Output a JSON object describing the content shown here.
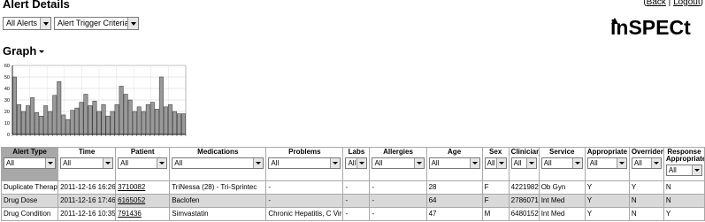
{
  "header": {
    "title": "Alert Details",
    "back_label": "Back",
    "separator": "|",
    "logout_label": "Logout",
    "logo_text": "inSPECt"
  },
  "filters": {
    "alerts_selected": "All Alerts",
    "criteria_selected": "Alert Trigger Criteria"
  },
  "graph": {
    "heading": "Graph",
    "icon": "chevron-down-icon"
  },
  "chart_data": {
    "type": "bar",
    "y_ticks": [
      "0",
      "10",
      "20",
      "30",
      "40",
      "50",
      "60"
    ],
    "ylim": [
      0,
      60
    ],
    "grid": true,
    "bar_color": "#999999",
    "values": [
      50,
      26,
      20,
      25,
      32,
      19,
      16,
      25,
      20,
      34,
      46,
      17,
      13,
      21,
      23,
      28,
      35,
      25,
      29,
      20,
      26,
      16,
      20,
      26,
      42,
      35,
      30,
      20,
      24,
      20,
      26,
      28,
      22,
      50,
      24,
      26,
      20,
      18,
      18
    ]
  },
  "table": {
    "columns": [
      {
        "label": "Alert Type",
        "filter": "All",
        "sorted": true
      },
      {
        "label": "Time",
        "filter": "All",
        "sorted": false
      },
      {
        "label": "Patient",
        "filter": "All",
        "sorted": false
      },
      {
        "label": "Medications",
        "filter": "All",
        "sorted": false
      },
      {
        "label": "Problems",
        "filter": "All",
        "sorted": false
      },
      {
        "label": "Labs",
        "filter": "All",
        "sorted": false
      },
      {
        "label": "Allergies",
        "filter": "All",
        "sorted": false
      },
      {
        "label": "Age",
        "filter": "All",
        "sorted": false
      },
      {
        "label": "Sex",
        "filter": "All",
        "sorted": false
      },
      {
        "label": "Clinician",
        "filter": "All",
        "sorted": false
      },
      {
        "label": "Service",
        "filter": "All",
        "sorted": false
      },
      {
        "label": "Appropriate",
        "filter": "All",
        "sorted": false
      },
      {
        "label": "Overriden",
        "filter": "All",
        "sorted": false
      },
      {
        "label": "Response Appropriate",
        "filter": "All",
        "sorted": false
      }
    ],
    "rows": [
      [
        "Duplicate Therapy",
        "2011-12-16 16:26",
        "3710082",
        "TriNessa (28) - Tri-Sprintec",
        "-",
        "-",
        "-",
        "28",
        "F",
        "4221982",
        "Ob Gyn",
        "Y",
        "Y",
        "N"
      ],
      [
        "Drug Dose",
        "2011-12-16 17:46",
        "6165052",
        "Baclofen",
        "-",
        "-",
        "-",
        "64",
        "F",
        "2786071",
        "Int Med",
        "Y",
        "N",
        "N"
      ],
      [
        "Drug Condition",
        "2011-12-16 10:35",
        "791436",
        "Simvastatin",
        "Chronic Hepatitis, C Virus",
        "-",
        "-",
        "47",
        "M",
        "6480152",
        "Int Med",
        "Y",
        "N",
        "Y"
      ]
    ]
  }
}
